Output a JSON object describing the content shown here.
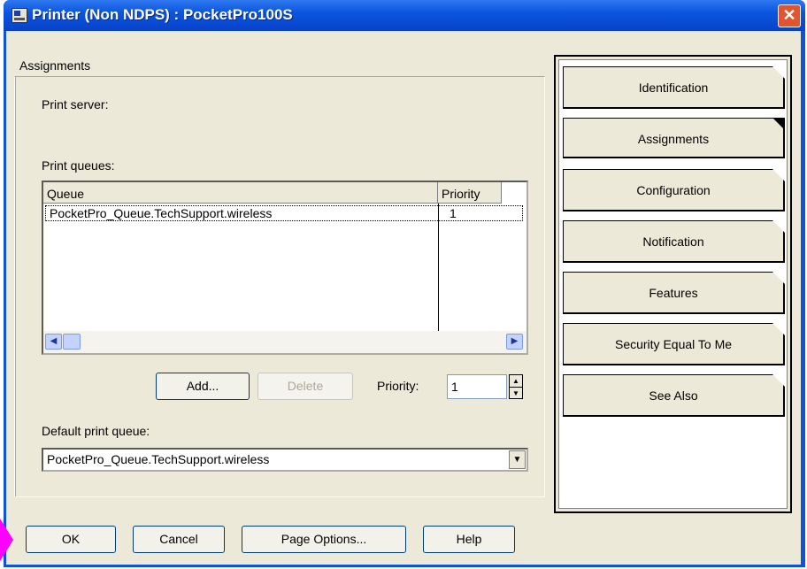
{
  "window": {
    "title": "Printer (Non NDPS) : PocketPro100S",
    "close_glyph": "✕"
  },
  "assignments": {
    "group_label": "Assignments",
    "print_server_label": "Print server:",
    "print_queues_label": "Print queues:",
    "queues_table": {
      "headers": [
        "Queue",
        "Priority"
      ],
      "rows": [
        {
          "queue": "PocketPro_Queue.TechSupport.wireless",
          "priority": "1"
        }
      ]
    },
    "add_button": "Add...",
    "delete_button": "Delete",
    "priority_label": "Priority:",
    "priority_value": "1",
    "default_queue_label": "Default print queue:",
    "default_queue_value": "PocketPro_Queue.TechSupport.wireless"
  },
  "tabs": [
    {
      "label": "Identification",
      "active": false
    },
    {
      "label": "Assignments",
      "active": true
    },
    {
      "label": "Configuration",
      "active": false
    },
    {
      "label": "Notification",
      "active": false
    },
    {
      "label": "Features",
      "active": false
    },
    {
      "label": "Security Equal To Me",
      "active": false
    },
    {
      "label": "See Also",
      "active": false
    }
  ],
  "footer": {
    "ok": "OK",
    "cancel": "Cancel",
    "page_options": "Page Options...",
    "help": "Help"
  },
  "colors": {
    "titlebar": "#0a56e0",
    "dialog_bg": "#ece9d8",
    "pointer": "#ff00ff",
    "close": "#e0542f"
  }
}
